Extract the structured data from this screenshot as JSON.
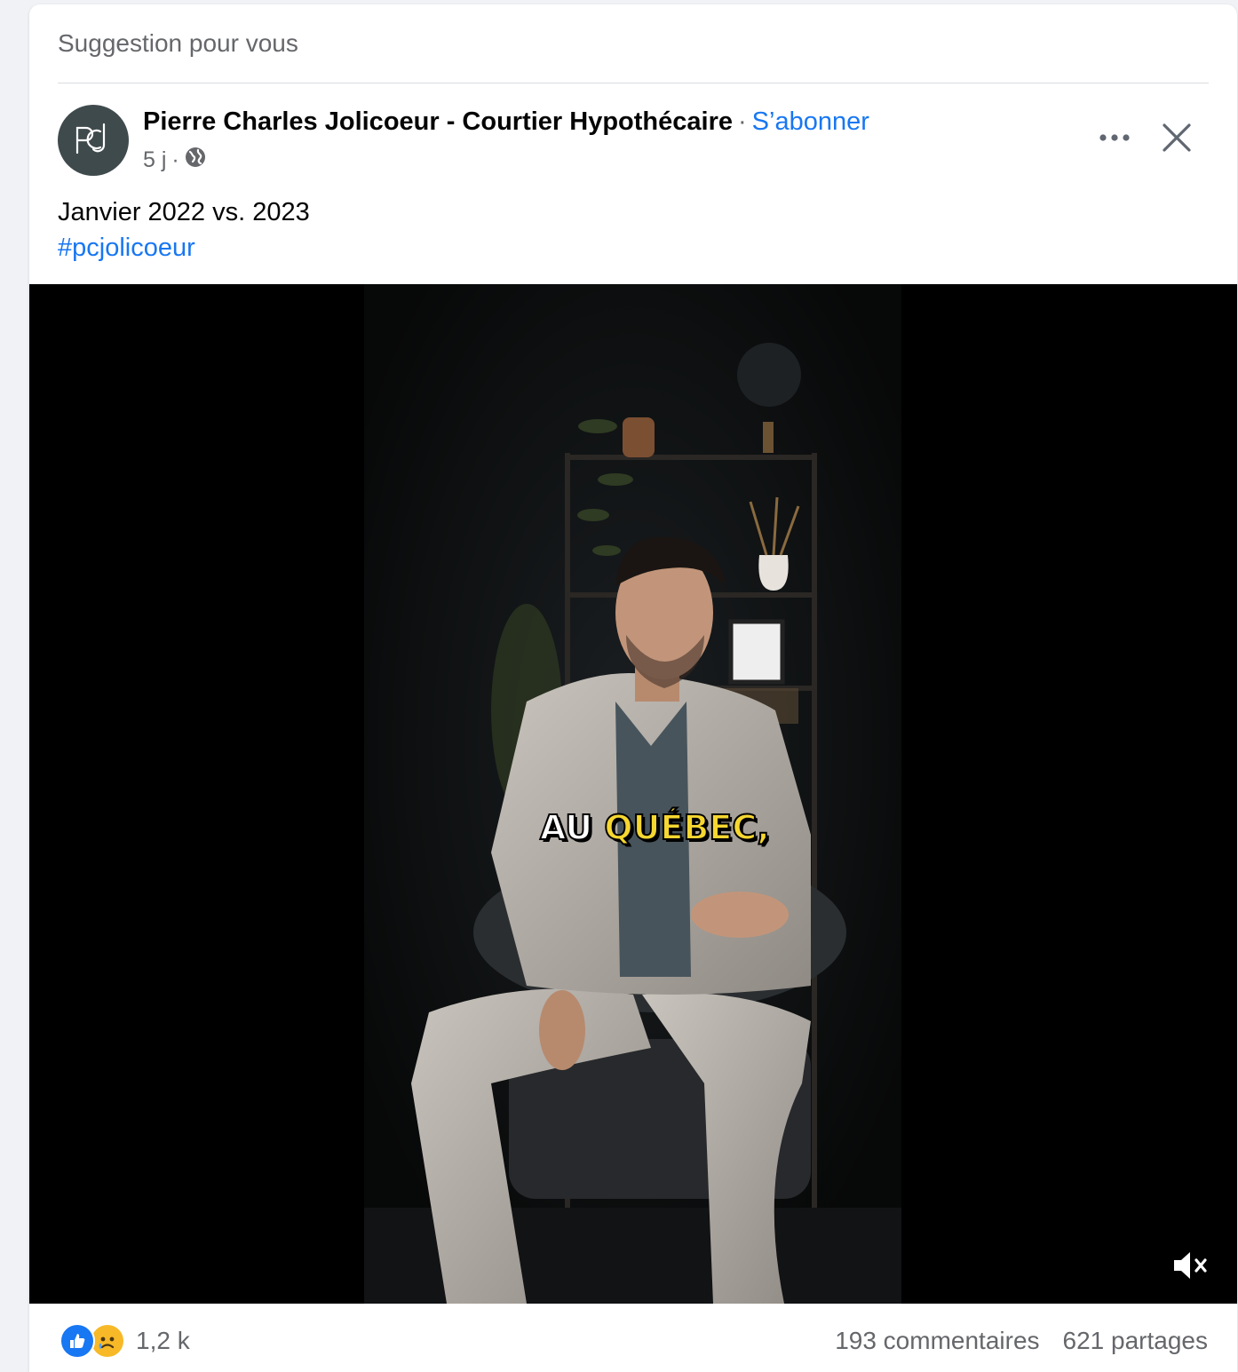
{
  "header": {
    "suggestion_label": "Suggestion pour vous"
  },
  "author": {
    "name": "Pierre Charles Jolicoeur - Courtier Hypothécaire",
    "separator": "·",
    "follow_label": "S’abonner",
    "time": "5 j",
    "meta_separator": "·",
    "privacy_icon": "globe-icon",
    "avatar_monogram": "PCJ"
  },
  "actions": {
    "more_icon": "more-dots-icon",
    "close_icon": "close-icon"
  },
  "post": {
    "text": "Janvier 2022 vs. 2023",
    "hashtag": "#pcjolicoeur"
  },
  "video": {
    "caption_white": "AU",
    "caption_yellow": "QUÉBEC,",
    "mute_icon": "muted-speaker-icon"
  },
  "footer": {
    "reaction_icons": [
      "like-icon",
      "sad-icon"
    ],
    "reaction_count": "1,2 k",
    "comments": "193 commentaires",
    "shares": "621 partages"
  },
  "colors": {
    "link": "#1877f2",
    "secondary_text": "#65676b",
    "caption_yellow": "#f6d731",
    "avatar_bg": "#3f4a4d"
  }
}
